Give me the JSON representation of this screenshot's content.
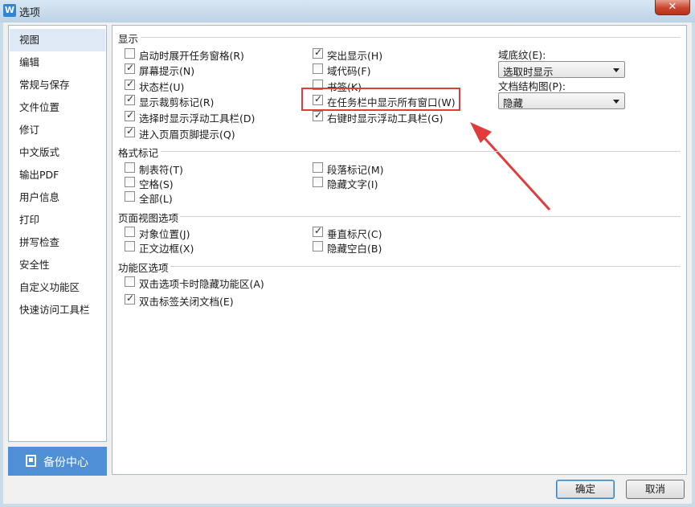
{
  "window": {
    "title": "选项",
    "app_icon": "W",
    "close_symbol": "✕"
  },
  "sidebar": {
    "items": [
      {
        "label": "视图",
        "selected": true
      },
      {
        "label": "编辑"
      },
      {
        "label": "常规与保存"
      },
      {
        "label": "文件位置"
      },
      {
        "label": "修订"
      },
      {
        "label": "中文版式"
      },
      {
        "label": "输出PDF"
      },
      {
        "label": "用户信息"
      },
      {
        "label": "打印"
      },
      {
        "label": "拼写检查"
      },
      {
        "label": "安全性"
      },
      {
        "label": "自定义功能区"
      },
      {
        "label": "快速访问工具栏"
      }
    ],
    "backup_button": "备份中心"
  },
  "display": {
    "title": "显示",
    "col1": [
      {
        "label": "启动时展开任务窗格(R)",
        "checked": false
      },
      {
        "label": "屏幕提示(N)",
        "checked": true
      },
      {
        "label": "状态栏(U)",
        "checked": true
      },
      {
        "label": "显示裁剪标记(R)",
        "checked": true
      },
      {
        "label": "选择时显示浮动工具栏(D)",
        "checked": true
      },
      {
        "label": "进入页眉页脚提示(Q)",
        "checked": true
      }
    ],
    "col2": [
      {
        "label": "突出显示(H)",
        "checked": true
      },
      {
        "label": "域代码(F)",
        "checked": false
      },
      {
        "label": "书签(K)",
        "checked": false
      },
      {
        "label": "在任务栏中显示所有窗口(W)",
        "checked": true
      },
      {
        "label": "右键时显示浮动工具栏(G)",
        "checked": true
      }
    ],
    "field_shading_label": "域底纹(E):",
    "field_shading_value": "选取时显示",
    "doc_map_label": "文档结构图(P):",
    "doc_map_value": "隐藏"
  },
  "format_marks": {
    "title": "格式标记",
    "items": [
      {
        "label": "制表符(T)",
        "checked": false
      },
      {
        "label": "段落标记(M)",
        "checked": false
      },
      {
        "label": "空格(S)",
        "checked": false
      },
      {
        "label": "隐藏文字(I)",
        "checked": false
      },
      {
        "label": "全部(L)",
        "checked": false
      }
    ]
  },
  "page_view": {
    "title": "页面视图选项",
    "items": [
      {
        "label": "对象位置(J)",
        "checked": false
      },
      {
        "label": "垂直标尺(C)",
        "checked": true
      },
      {
        "label": "正文边框(X)",
        "checked": false
      },
      {
        "label": "隐藏空白(B)",
        "checked": false
      }
    ]
  },
  "ribbon": {
    "title": "功能区选项",
    "items": [
      {
        "label": "双击选项卡时隐藏功能区(A)",
        "checked": false
      },
      {
        "label": "双击标签关闭文档(E)",
        "checked": true
      }
    ]
  },
  "buttons": {
    "ok": "确定",
    "cancel": "取消"
  },
  "colors": {
    "highlight": "#e23b3b",
    "accent": "#4f8fd6"
  }
}
